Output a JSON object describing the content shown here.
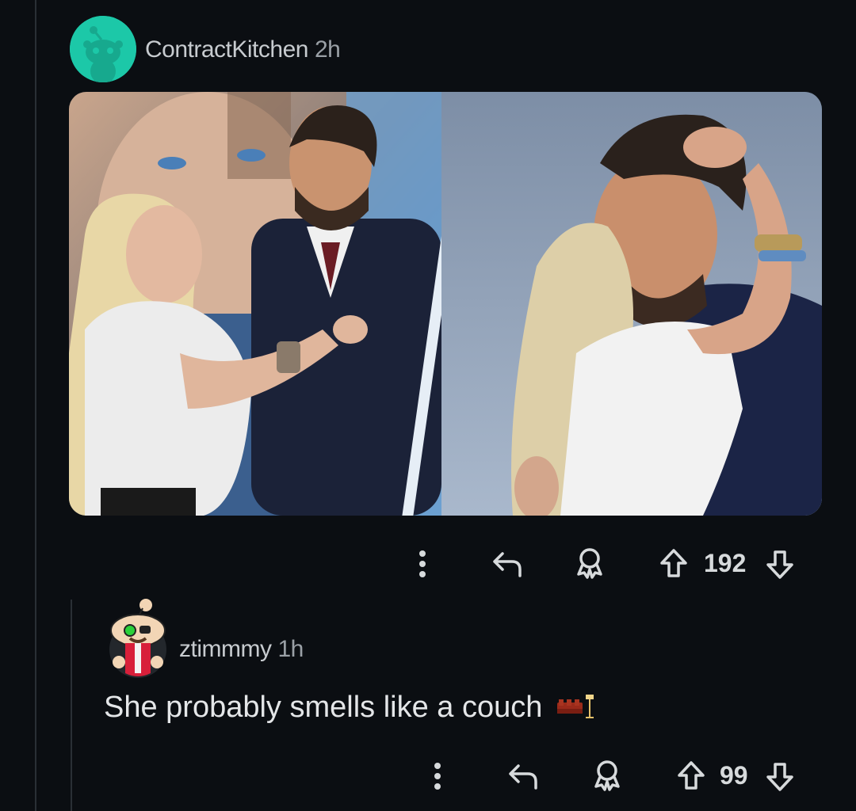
{
  "post": {
    "author": "ContractKitchen",
    "age": "2h",
    "image_alt": "Two-panel photo of a blonde woman in a white t-shirt embracing a bearded man in a dark suit on a stage",
    "score": "192"
  },
  "reply": {
    "author": "ztimmmy",
    "age": "1h",
    "body": "She probably smells like a couch",
    "score": "99"
  },
  "colors": {
    "background": "#0b0e12",
    "avatar_teal": "#1cc8a8",
    "text": "#d7dadc",
    "muted": "#9aa0a6"
  },
  "icons": [
    "more-vertical-icon",
    "reply-icon",
    "award-icon",
    "upvote-icon",
    "downvote-icon",
    "couch-emoji-icon"
  ]
}
